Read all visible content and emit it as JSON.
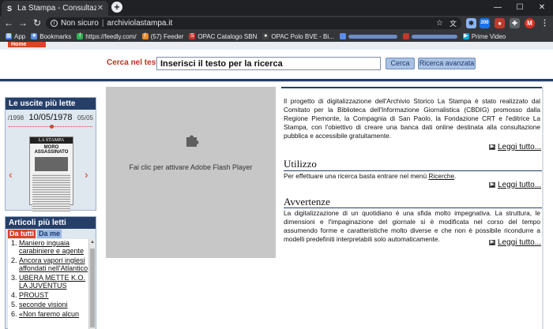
{
  "browser": {
    "tab_title": "La Stampa - Consultazione Archivio",
    "tab_favicon": "S",
    "new_tab": "+",
    "security_label": "Non sicuro",
    "url": "archiviolastampa.it",
    "ext_badge": "200",
    "profile_initial": "M",
    "window_controls": [
      "—",
      "☐",
      "✕"
    ]
  },
  "bookmarks": [
    {
      "label": "App",
      "color": "#4285f4",
      "icon": "apps-icon"
    },
    {
      "label": "Bookmarks",
      "color": "#5b8def",
      "icon": "star-icon"
    },
    {
      "label": "https://feedly.com/",
      "color": "#2bb24c",
      "icon": "feedly-icon"
    },
    {
      "label": "(57) Feeder",
      "color": "#f08c2b",
      "icon": "feeder-icon"
    },
    {
      "label": "OPAC Catalogo SBN",
      "color": "#c0392b",
      "icon": "sbn-icon"
    },
    {
      "label": "OPAC Polo BVE - Bi...",
      "color": "#444444",
      "icon": "bve-icon"
    },
    {
      "label": "",
      "color": "#5b8def",
      "icon": "blurred-icon"
    },
    {
      "label": "",
      "color": "#c0392b",
      "icon": "blurred-icon"
    },
    {
      "label": "Prime Video",
      "color": "#00a8e1",
      "icon": "prime-video-icon"
    }
  ],
  "page": {
    "home_tab": "Home",
    "search_label": "Cerca nel testo",
    "search_value": "Inserisci il testo per la ricerca",
    "search_button": "Cerca",
    "advanced_button": "Ricerca avanzata"
  },
  "issues_panel": {
    "title": "Le uscite più lette",
    "start_year": "/1998",
    "current_date": "10/05/1978",
    "end_date": "05/05",
    "masthead": "LA STAMPA",
    "headline": "MORO ASSASSINATO",
    "arrow_prev": "‹",
    "arrow_next": "›"
  },
  "articles_panel": {
    "title": "Articoli più letti",
    "tab_all": "Da tutti",
    "tab_me": "Da me",
    "items": [
      "Maniero inguaia carabiniere e agente",
      "Ancora vapori inglesi affondati nell'Atlantico",
      "UBERA METTE K.O. LA JUVENTUS",
      "PROUST",
      "seconde visioni",
      "«Non faremo alcun"
    ]
  },
  "flash": {
    "message": "Fai clic per attivare Adobe Flash Player"
  },
  "info": {
    "intro": "Il progetto di digitalizzazione dell'Archivio Storico La Stampa è stato realizzato dal Comitato per la Biblioteca dell'Informazione Giornalistica (CBDIG) promosso dalla Regione Piemonte, la Compagnia di San Paolo, la Fondazione CRT e l'editrice La Stampa, con l'obiettivo di creare una banca dati online destinata alla consultazione pubblica e accessibile gratuitamente.",
    "read_more": "Leggi tutto...",
    "utilizzo_title": "Utilizzo",
    "utilizzo_text": "Per effettuare una ricerca basta entrare nel menù",
    "utilizzo_link": "Ricerche",
    "utilizzo_end": ".",
    "avvertenze_title": "Avvertenze",
    "avvertenze_text": "La digitalizzazione di un quotidiano è una sfida molto impegnativa. La struttura, le dimensioni e l'impaginazione del giornale si è modificata nel corso del tempo assumendo forme e caratteristiche molto diverse e che non è possibile ricondurre a modelli predefiniti interpretabili solo automaticamente."
  }
}
